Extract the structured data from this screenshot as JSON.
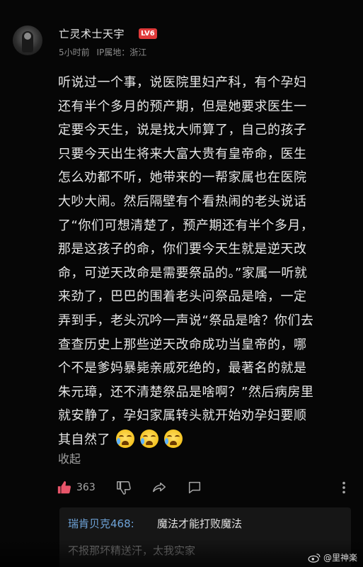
{
  "post": {
    "username": "亡灵术士天宇",
    "level": "LV6",
    "time": "5小时前",
    "ip_location": "IP属地：浙江",
    "lines": [
      "听说过一个事，说医院里妇产科，有个孕妇",
      "还有半个多月的预产期，但是她要求医生一",
      "定要今天生，说是找大师算了，自己的孩子",
      "只要今天出生将来大富大贵有皇帝命，医生",
      "怎么劝都不听，她带来的一帮家属也在医院",
      "大吵大闹。然后隔壁有个看热闹的老头说话",
      "了“你们可想清楚了，预产期还有半个多月，",
      "那是这孩子的命，你们要今天生就是逆天改",
      "命，可逆天改命是需要祭品的。”家属一听就",
      "来劲了，巴巴的围着老头问祭品是啥，一定",
      "弄到手，老头沉吟一声说“祭品是啥？你们去",
      "查查历史上那些逆天改命成功当皇帝的，哪",
      "个不是爹妈暴毙亲戚死绝的，最著名的就是",
      "朱元璋，还不清楚祭品是啥啊？”然后病房里",
      "就安静了，孕妇家属转头就开始劝孕妇要顺",
      "其自然了"
    ],
    "collapse_label": "收起",
    "like_count": "363"
  },
  "reply": {
    "name": "瑞肯贝克468:",
    "text": "魔法才能打败魔法",
    "partial_next": "不报那坏精送汗，太我实家"
  },
  "watermark": "@里神楽",
  "colors": {
    "background": "#060606",
    "text": "#e6e6e6",
    "meta": "#8c8c8c",
    "like_accent": "#e8556a",
    "reply_name": "#6ea3d8",
    "level_badge": "#e03a3a"
  },
  "icons": [
    "thumbs-up-icon",
    "thumbs-down-icon",
    "share-icon",
    "comment-icon",
    "more-icon",
    "crying-emoji-icon",
    "weibo-icon"
  ]
}
